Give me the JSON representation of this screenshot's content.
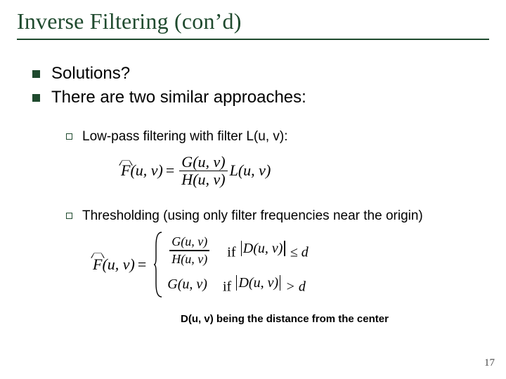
{
  "title": "Inverse Filtering (con’d)",
  "bullets": {
    "b1": "Solutions?",
    "b2": "There are two similar approaches:"
  },
  "subs": {
    "s1": "Low-pass filtering with filter L(u, v):",
    "s2": "Thresholding (using only filter frequencies near the origin)"
  },
  "eq1": {
    "lhs_F": "F",
    "args": "(u, v)",
    "G": "G",
    "H": "H",
    "L": "L"
  },
  "eq2": {
    "F": "F",
    "args": "(u, v)",
    "G": "G",
    "H": "H",
    "if1": "if ",
    "if2": "if ",
    "D": "D",
    "le": " ≤ ",
    "gt": " > ",
    "d": "d"
  },
  "caption": "D(u, v) being the distance from the center",
  "pagenum": "17"
}
